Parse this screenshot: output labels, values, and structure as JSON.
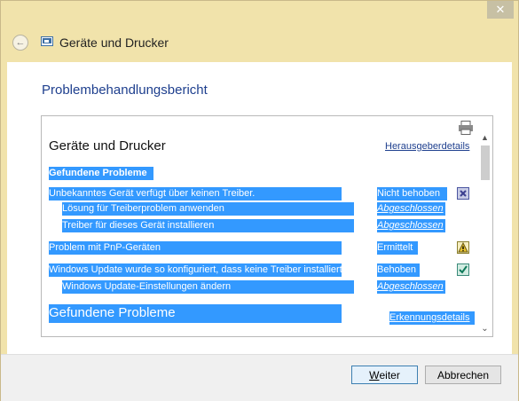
{
  "window": {
    "title": "Geräte und Drucker",
    "close_glyph": "✕"
  },
  "page": {
    "title": "Problembehandlungsbericht"
  },
  "report": {
    "heading": "Geräte und Drucker",
    "publisher_link": "Herausgeberdetails",
    "section1_label": "Gefundene Probleme",
    "rows": [
      {
        "text": "Unbekanntes Gerät verfügt über keinen Treiber.",
        "status": "Nicht behoben",
        "icon": "error-x-icon"
      },
      {
        "text": "Lösung für Treiberproblem anwenden",
        "status": "Abgeschlossen"
      },
      {
        "text": "Treiber für dieses Gerät installieren",
        "status": "Abgeschlossen"
      },
      {
        "text": "Problem mit PnP-Geräten",
        "status": "Ermittelt",
        "icon": "warning-icon"
      },
      {
        "text": "Windows Update wurde so konfiguriert, dass keine Treiber installiert werden",
        "status": "Behoben",
        "icon": "check-icon"
      },
      {
        "text": "Windows Update-Einstellungen ändern",
        "status": "Abgeschlossen"
      }
    ],
    "section2_label": "Gefundene Probleme",
    "detection_link": "Erkennungsdetails"
  },
  "buttons": {
    "next_prefix": "W",
    "next_rest": "eiter",
    "cancel": "Abbrechen"
  },
  "colors": {
    "frame": "#f1e3ab",
    "selection": "#3399ff",
    "link": "#1e3f8e"
  }
}
